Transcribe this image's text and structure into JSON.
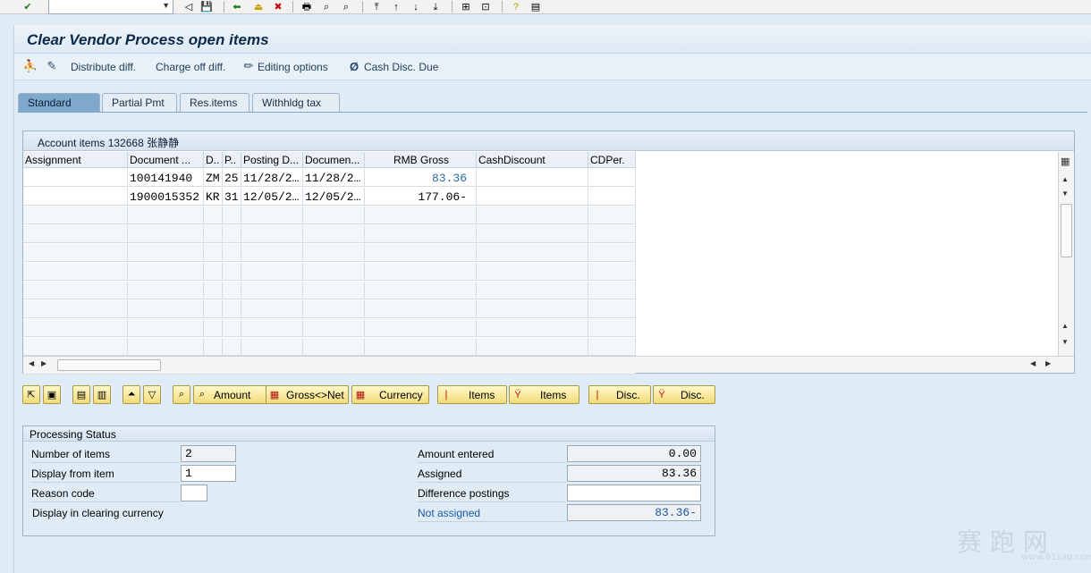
{
  "window": {
    "title": "Clear Vendor Process open items"
  },
  "app_toolbar": {
    "distribute": "Distribute diff.",
    "charge_off": "Charge off diff.",
    "editing_options": "Editing options",
    "cash_disc_due": "Cash Disc. Due"
  },
  "tabs": [
    {
      "label": "Standard"
    },
    {
      "label": "Partial Pmt"
    },
    {
      "label": "Res.items"
    },
    {
      "label": "Withhldg tax"
    }
  ],
  "table": {
    "title": "Account items 132668 张静静",
    "columns": [
      "Assignment",
      "Document ...",
      "D..",
      "P..",
      "Posting D...",
      "Documen...",
      "RMB Gross",
      "CashDiscount",
      "CDPer."
    ],
    "rows": [
      [
        "",
        "100141940",
        "ZM",
        "25",
        "11/28/2…",
        "11/28/2…",
        "83.36",
        "",
        ""
      ],
      [
        "",
        "1900015352",
        "KR",
        "31",
        "12/05/2…",
        "12/05/2…",
        "177.06-",
        "",
        ""
      ]
    ]
  },
  "buttons": {
    "amount": "Amount",
    "gross_net": "Gross<>Net",
    "currency": "Currency",
    "items1": "Items",
    "items2": "Items",
    "disc1": "Disc.",
    "disc2": "Disc."
  },
  "status": {
    "title": "Processing Status",
    "number_of_items_label": "Number of items",
    "number_of_items": "2",
    "display_from_label": "Display from item",
    "display_from": "1",
    "reason_code_label": "Reason code",
    "reason_code": "",
    "display_clearing_label": "Display in clearing currency",
    "amount_entered_label": "Amount entered",
    "amount_entered": "0.00",
    "assigned_label": "Assigned",
    "assigned": "83.36",
    "difference_label": "Difference postings",
    "difference": "",
    "not_assigned_label": "Not assigned",
    "not_assigned": "83.36-"
  },
  "watermark": {
    "text": "赛 跑 网",
    "url": "www.91sap.com"
  },
  "colors": {
    "accent": "#7fa8cc",
    "link_blue": "#1a58a8",
    "button_yellow": "#f2dc7a"
  }
}
